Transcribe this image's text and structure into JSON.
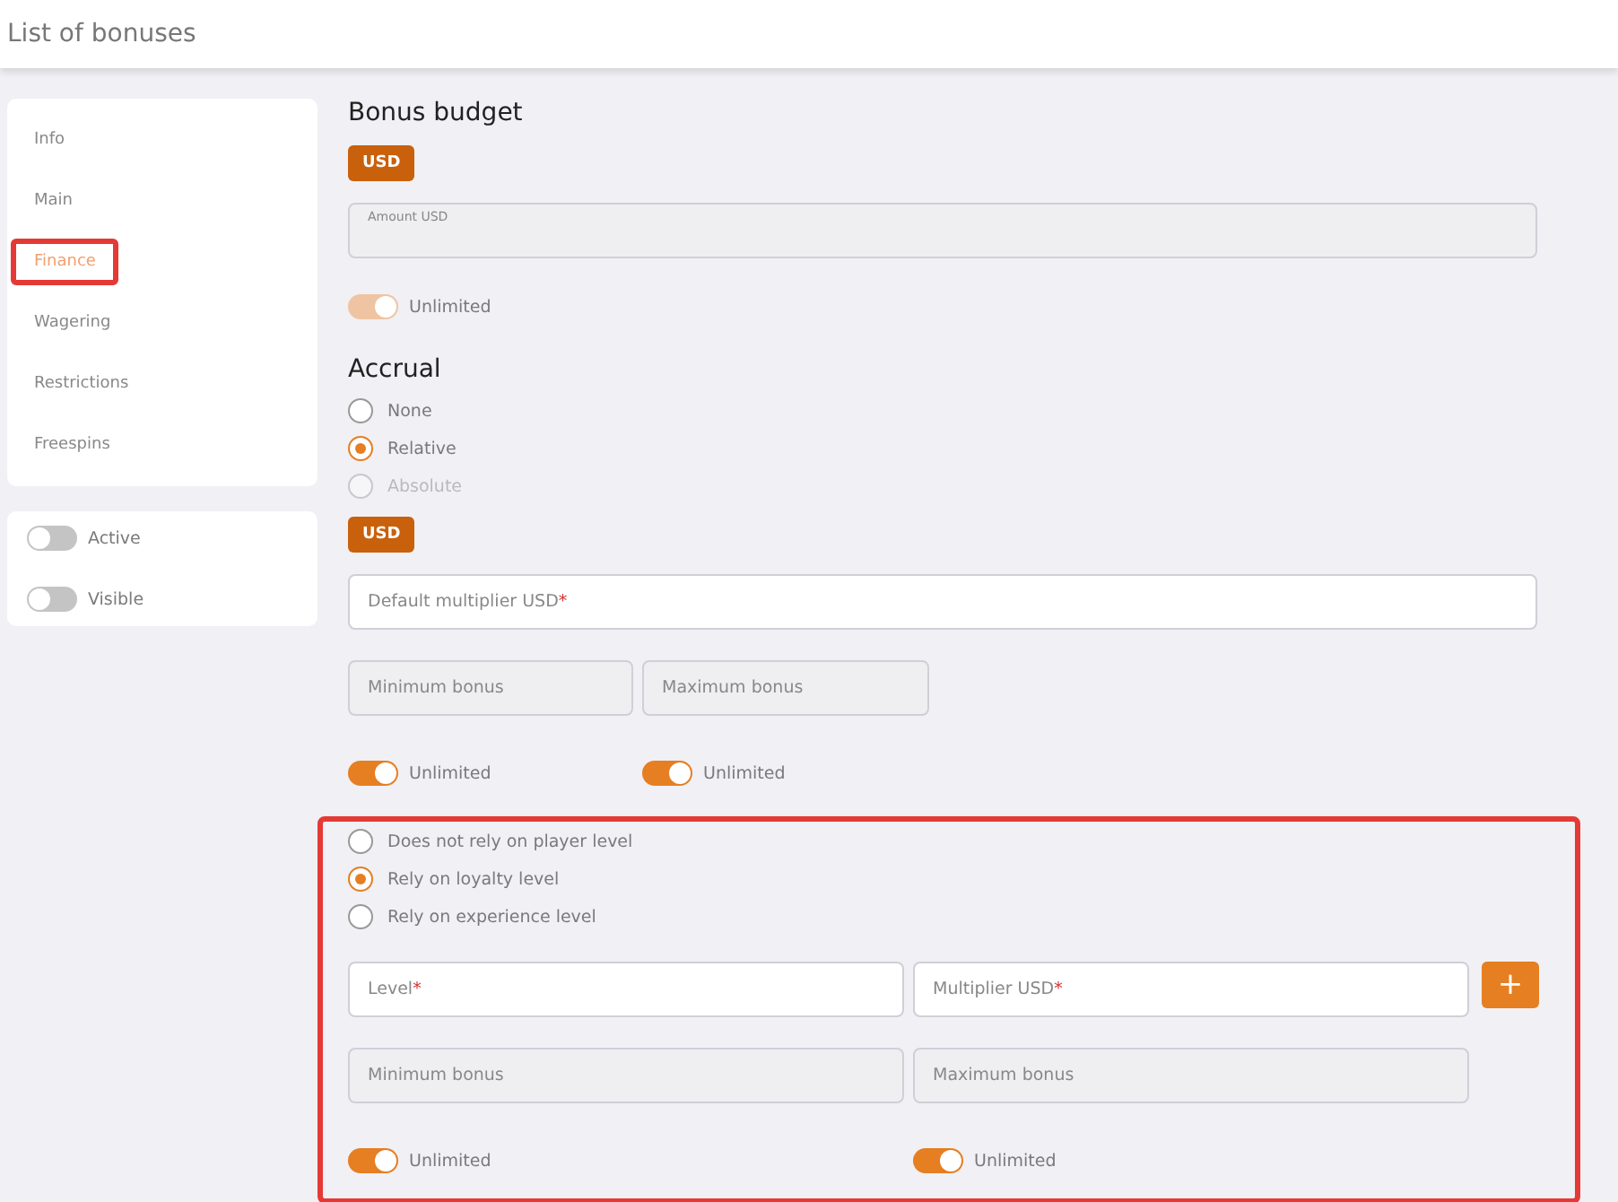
{
  "header": {
    "title": "List of bonuses"
  },
  "sidebar": {
    "items": [
      {
        "label": "Info",
        "selected": false,
        "highlighted": false
      },
      {
        "label": "Main",
        "selected": false,
        "highlighted": false
      },
      {
        "label": "Finance",
        "selected": true,
        "highlighted": true
      },
      {
        "label": "Wagering",
        "selected": false,
        "highlighted": false
      },
      {
        "label": "Restrictions",
        "selected": false,
        "highlighted": false
      },
      {
        "label": "Freespins",
        "selected": false,
        "highlighted": false
      }
    ],
    "switches": [
      {
        "label": "Active",
        "on": false
      },
      {
        "label": "Visible",
        "on": false
      }
    ]
  },
  "budget": {
    "heading": "Bonus budget",
    "currency": "USD",
    "amount_field": {
      "label": "Amount USD",
      "disabled": true
    },
    "toggle": {
      "label": "Unlimited",
      "on": true,
      "disabled": true
    }
  },
  "accrual": {
    "heading": "Accrual",
    "options": [
      {
        "label": "None",
        "selected": false,
        "disabled": false
      },
      {
        "label": "Relative",
        "selected": true,
        "disabled": false
      },
      {
        "label": "Absolute",
        "selected": false,
        "disabled": true
      }
    ],
    "currency": "USD",
    "multiplier_field": {
      "placeholder": "Default multiplier USD",
      "required_mark": "*",
      "disabled": false
    },
    "limits": [
      {
        "field": {
          "placeholder": "Minimum bonus",
          "disabled": true
        },
        "toggle": {
          "label": "Unlimited",
          "on": true,
          "disabled": false
        }
      },
      {
        "field": {
          "placeholder": "Maximum bonus",
          "disabled": true
        },
        "toggle": {
          "label": "Unlimited",
          "on": true,
          "disabled": false
        }
      }
    ]
  },
  "level_section": {
    "highlighted": true,
    "options": [
      {
        "label": "Does not rely on player level",
        "selected": false,
        "disabled": false
      },
      {
        "label": "Rely on loyalty level",
        "selected": true,
        "disabled": false
      },
      {
        "label": "Rely on experience level",
        "selected": false,
        "disabled": false
      }
    ],
    "level_field": {
      "placeholder": "Level",
      "required_mark": "*",
      "disabled": false
    },
    "multiplier_field": {
      "placeholder": "Multiplier USD",
      "required_mark": "*",
      "disabled": false
    },
    "add_button": "+",
    "limits": [
      {
        "field": {
          "placeholder": "Minimum bonus",
          "disabled": true
        },
        "toggle": {
          "label": "Unlimited",
          "on": true,
          "disabled": false
        }
      },
      {
        "field": {
          "placeholder": "Maximum bonus",
          "disabled": true
        },
        "toggle": {
          "label": "Unlimited",
          "on": true,
          "disabled": false
        }
      }
    ]
  }
}
